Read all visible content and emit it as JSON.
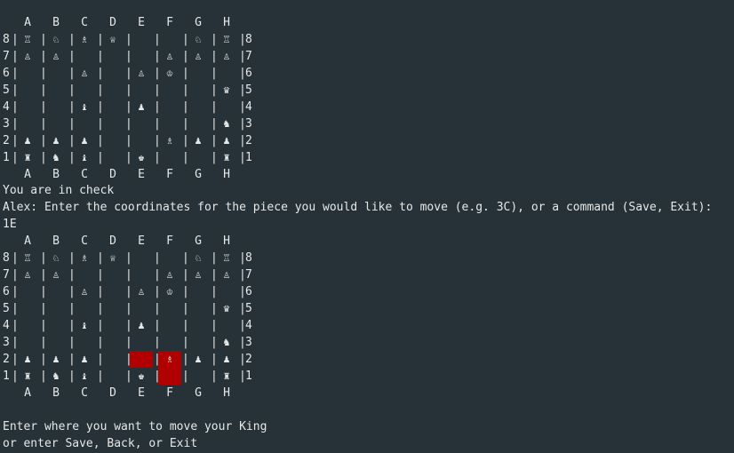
{
  "colors": {
    "background": "#263238",
    "text": "#e6e8e8",
    "highlight": "#b00000"
  },
  "files": [
    "A",
    "B",
    "C",
    "D",
    "E",
    "F",
    "G",
    "H"
  ],
  "rank_labels": [
    "8",
    "7",
    "6",
    "5",
    "4",
    "3",
    "2",
    "1"
  ],
  "board_1": {
    "rows": [
      [
        "♖",
        "♘",
        "♗",
        "♕",
        "",
        "",
        "♘",
        "♖"
      ],
      [
        "♙",
        "♙",
        "",
        "",
        "",
        "♙",
        "♙",
        "♙"
      ],
      [
        "",
        "",
        "♙",
        "",
        "♙",
        "♔",
        "",
        ""
      ],
      [
        "",
        "",
        "",
        "",
        "",
        "",
        "",
        "♛"
      ],
      [
        "",
        "",
        "♝",
        "",
        "♟",
        "",
        "",
        ""
      ],
      [
        "",
        "",
        "",
        "",
        "",
        "",
        "",
        "♞"
      ],
      [
        "♟",
        "♟",
        "♟",
        "",
        "",
        "♗",
        "♟",
        "♟"
      ],
      [
        "♜",
        "♞",
        "♝",
        "",
        "♚",
        "",
        "",
        "♜"
      ]
    ],
    "highlights": []
  },
  "board_2": {
    "rows": [
      [
        "♖",
        "♘",
        "♗",
        "♕",
        "",
        "",
        "♘",
        "♖"
      ],
      [
        "♙",
        "♙",
        "",
        "",
        "",
        "♙",
        "♙",
        "♙"
      ],
      [
        "",
        "",
        "♙",
        "",
        "♙",
        "♔",
        "",
        ""
      ],
      [
        "",
        "",
        "",
        "",
        "",
        "",
        "",
        "♛"
      ],
      [
        "",
        "",
        "♝",
        "",
        "♟",
        "",
        "",
        ""
      ],
      [
        "",
        "",
        "",
        "",
        "",
        "",
        "",
        "♞"
      ],
      [
        "♟",
        "♟",
        "♟",
        "",
        "",
        "♗",
        "♟",
        "♟"
      ],
      [
        "♜",
        "♞",
        "♝",
        "",
        "♚",
        "",
        "",
        "♜"
      ]
    ],
    "highlights": [
      "E2",
      "F2",
      "F1"
    ]
  },
  "messages": {
    "check": "You are in check",
    "prompt": "Alex: Enter the coordinates for the piece you would like to move (e.g. 3C), or a command (Save, Exit):",
    "input": "1E",
    "move_prompt": "Enter where you want to move your King",
    "options": "or enter Save, Back, or Exit"
  }
}
